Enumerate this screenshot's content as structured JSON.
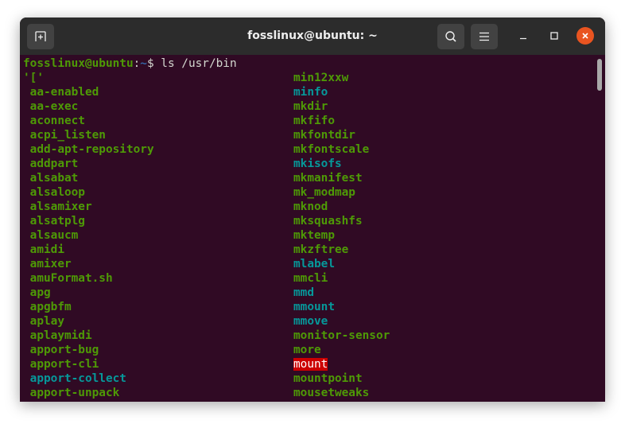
{
  "window": {
    "title": "fosslinux@ubuntu: ~",
    "new_tab_icon": "new-tab-icon",
    "search_icon": "search-icon",
    "menu_icon": "hamburger-menu-icon",
    "minimize_icon": "minimize-icon",
    "maximize_icon": "maximize-icon",
    "close_icon": "close-icon",
    "close_color": "#e95420"
  },
  "terminal": {
    "background": "#300a24",
    "prompt": {
      "user_host": "fosslinux@ubuntu",
      "separator": ":",
      "path": "~",
      "symbol": "$",
      "command": " ls /usr/bin"
    },
    "left_column": [
      {
        "name": "'['",
        "type": "exec"
      },
      {
        "name": " aa-enabled",
        "type": "exec"
      },
      {
        "name": " aa-exec",
        "type": "exec"
      },
      {
        "name": " aconnect",
        "type": "exec"
      },
      {
        "name": " acpi_listen",
        "type": "exec"
      },
      {
        "name": " add-apt-repository",
        "type": "exec"
      },
      {
        "name": " addpart",
        "type": "exec"
      },
      {
        "name": " alsabat",
        "type": "exec"
      },
      {
        "name": " alsaloop",
        "type": "exec"
      },
      {
        "name": " alsamixer",
        "type": "exec"
      },
      {
        "name": " alsatplg",
        "type": "exec"
      },
      {
        "name": " alsaucm",
        "type": "exec"
      },
      {
        "name": " amidi",
        "type": "exec"
      },
      {
        "name": " amixer",
        "type": "exec"
      },
      {
        "name": " amuFormat.sh",
        "type": "exec"
      },
      {
        "name": " apg",
        "type": "exec"
      },
      {
        "name": " apgbfm",
        "type": "exec"
      },
      {
        "name": " aplay",
        "type": "exec"
      },
      {
        "name": " aplaymidi",
        "type": "exec"
      },
      {
        "name": " apport-bug",
        "type": "exec"
      },
      {
        "name": " apport-cli",
        "type": "exec"
      },
      {
        "name": " apport-collect",
        "type": "link"
      },
      {
        "name": " apport-unpack",
        "type": "exec"
      }
    ],
    "right_column": [
      {
        "name": "min12xxw",
        "type": "exec"
      },
      {
        "name": "minfo",
        "type": "link"
      },
      {
        "name": "mkdir",
        "type": "exec"
      },
      {
        "name": "mkfifo",
        "type": "exec"
      },
      {
        "name": "mkfontdir",
        "type": "exec"
      },
      {
        "name": "mkfontscale",
        "type": "exec"
      },
      {
        "name": "mkisofs",
        "type": "link"
      },
      {
        "name": "mkmanifest",
        "type": "exec"
      },
      {
        "name": "mk_modmap",
        "type": "exec"
      },
      {
        "name": "mknod",
        "type": "exec"
      },
      {
        "name": "mksquashfs",
        "type": "exec"
      },
      {
        "name": "mktemp",
        "type": "exec"
      },
      {
        "name": "mkzftree",
        "type": "exec"
      },
      {
        "name": "mlabel",
        "type": "link"
      },
      {
        "name": "mmcli",
        "type": "exec"
      },
      {
        "name": "mmd",
        "type": "link"
      },
      {
        "name": "mmount",
        "type": "link"
      },
      {
        "name": "mmove",
        "type": "link"
      },
      {
        "name": "monitor-sensor",
        "type": "exec"
      },
      {
        "name": "more",
        "type": "exec"
      },
      {
        "name": "mount",
        "type": "suid"
      },
      {
        "name": "mountpoint",
        "type": "exec"
      },
      {
        "name": "mousetweaks",
        "type": "exec"
      }
    ],
    "colors": {
      "exec": "#4e9a06",
      "link": "#06989a",
      "suid_bg": "#cc0000",
      "suid_fg": "#ffffff"
    }
  }
}
